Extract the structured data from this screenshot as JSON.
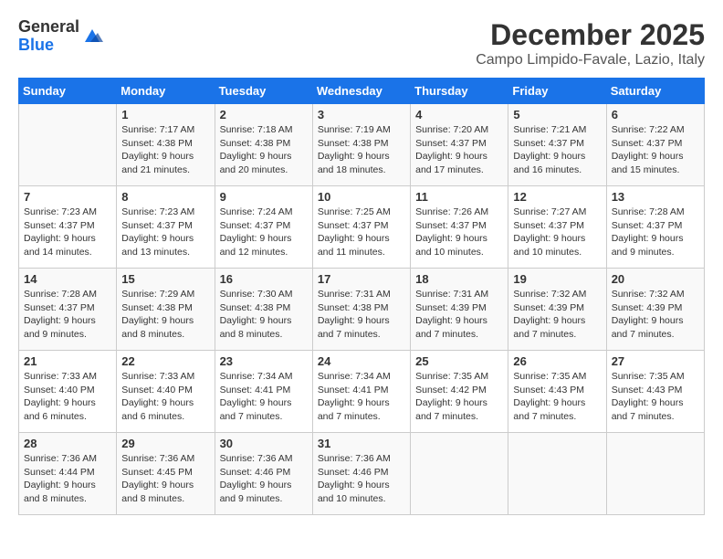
{
  "logo": {
    "general": "General",
    "blue": "Blue"
  },
  "title": "December 2025",
  "location": "Campo Limpido-Favale, Lazio, Italy",
  "days_of_week": [
    "Sunday",
    "Monday",
    "Tuesday",
    "Wednesday",
    "Thursday",
    "Friday",
    "Saturday"
  ],
  "weeks": [
    [
      {
        "day": "",
        "info": ""
      },
      {
        "day": "1",
        "info": "Sunrise: 7:17 AM\nSunset: 4:38 PM\nDaylight: 9 hours\nand 21 minutes."
      },
      {
        "day": "2",
        "info": "Sunrise: 7:18 AM\nSunset: 4:38 PM\nDaylight: 9 hours\nand 20 minutes."
      },
      {
        "day": "3",
        "info": "Sunrise: 7:19 AM\nSunset: 4:38 PM\nDaylight: 9 hours\nand 18 minutes."
      },
      {
        "day": "4",
        "info": "Sunrise: 7:20 AM\nSunset: 4:37 PM\nDaylight: 9 hours\nand 17 minutes."
      },
      {
        "day": "5",
        "info": "Sunrise: 7:21 AM\nSunset: 4:37 PM\nDaylight: 9 hours\nand 16 minutes."
      },
      {
        "day": "6",
        "info": "Sunrise: 7:22 AM\nSunset: 4:37 PM\nDaylight: 9 hours\nand 15 minutes."
      }
    ],
    [
      {
        "day": "7",
        "info": "Sunrise: 7:23 AM\nSunset: 4:37 PM\nDaylight: 9 hours\nand 14 minutes."
      },
      {
        "day": "8",
        "info": "Sunrise: 7:23 AM\nSunset: 4:37 PM\nDaylight: 9 hours\nand 13 minutes."
      },
      {
        "day": "9",
        "info": "Sunrise: 7:24 AM\nSunset: 4:37 PM\nDaylight: 9 hours\nand 12 minutes."
      },
      {
        "day": "10",
        "info": "Sunrise: 7:25 AM\nSunset: 4:37 PM\nDaylight: 9 hours\nand 11 minutes."
      },
      {
        "day": "11",
        "info": "Sunrise: 7:26 AM\nSunset: 4:37 PM\nDaylight: 9 hours\nand 10 minutes."
      },
      {
        "day": "12",
        "info": "Sunrise: 7:27 AM\nSunset: 4:37 PM\nDaylight: 9 hours\nand 10 minutes."
      },
      {
        "day": "13",
        "info": "Sunrise: 7:28 AM\nSunset: 4:37 PM\nDaylight: 9 hours\nand 9 minutes."
      }
    ],
    [
      {
        "day": "14",
        "info": "Sunrise: 7:28 AM\nSunset: 4:37 PM\nDaylight: 9 hours\nand 9 minutes."
      },
      {
        "day": "15",
        "info": "Sunrise: 7:29 AM\nSunset: 4:38 PM\nDaylight: 9 hours\nand 8 minutes."
      },
      {
        "day": "16",
        "info": "Sunrise: 7:30 AM\nSunset: 4:38 PM\nDaylight: 9 hours\nand 8 minutes."
      },
      {
        "day": "17",
        "info": "Sunrise: 7:31 AM\nSunset: 4:38 PM\nDaylight: 9 hours\nand 7 minutes."
      },
      {
        "day": "18",
        "info": "Sunrise: 7:31 AM\nSunset: 4:39 PM\nDaylight: 9 hours\nand 7 minutes."
      },
      {
        "day": "19",
        "info": "Sunrise: 7:32 AM\nSunset: 4:39 PM\nDaylight: 9 hours\nand 7 minutes."
      },
      {
        "day": "20",
        "info": "Sunrise: 7:32 AM\nSunset: 4:39 PM\nDaylight: 9 hours\nand 7 minutes."
      }
    ],
    [
      {
        "day": "21",
        "info": "Sunrise: 7:33 AM\nSunset: 4:40 PM\nDaylight: 9 hours\nand 6 minutes."
      },
      {
        "day": "22",
        "info": "Sunrise: 7:33 AM\nSunset: 4:40 PM\nDaylight: 9 hours\nand 6 minutes."
      },
      {
        "day": "23",
        "info": "Sunrise: 7:34 AM\nSunset: 4:41 PM\nDaylight: 9 hours\nand 7 minutes."
      },
      {
        "day": "24",
        "info": "Sunrise: 7:34 AM\nSunset: 4:41 PM\nDaylight: 9 hours\nand 7 minutes."
      },
      {
        "day": "25",
        "info": "Sunrise: 7:35 AM\nSunset: 4:42 PM\nDaylight: 9 hours\nand 7 minutes."
      },
      {
        "day": "26",
        "info": "Sunrise: 7:35 AM\nSunset: 4:43 PM\nDaylight: 9 hours\nand 7 minutes."
      },
      {
        "day": "27",
        "info": "Sunrise: 7:35 AM\nSunset: 4:43 PM\nDaylight: 9 hours\nand 7 minutes."
      }
    ],
    [
      {
        "day": "28",
        "info": "Sunrise: 7:36 AM\nSunset: 4:44 PM\nDaylight: 9 hours\nand 8 minutes."
      },
      {
        "day": "29",
        "info": "Sunrise: 7:36 AM\nSunset: 4:45 PM\nDaylight: 9 hours\nand 8 minutes."
      },
      {
        "day": "30",
        "info": "Sunrise: 7:36 AM\nSunset: 4:46 PM\nDaylight: 9 hours\nand 9 minutes."
      },
      {
        "day": "31",
        "info": "Sunrise: 7:36 AM\nSunset: 4:46 PM\nDaylight: 9 hours\nand 10 minutes."
      },
      {
        "day": "",
        "info": ""
      },
      {
        "day": "",
        "info": ""
      },
      {
        "day": "",
        "info": ""
      }
    ]
  ]
}
